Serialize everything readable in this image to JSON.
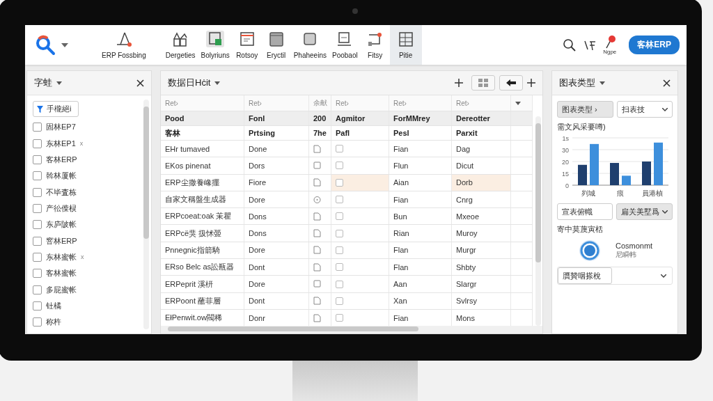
{
  "toolbar": {
    "tools": [
      {
        "label": "ERP Fossbing",
        "selected": false
      },
      {
        "label": "Dergeties",
        "selected": false
      },
      {
        "label": "Bolyriuns",
        "selected": false
      },
      {
        "label": "Rotsoy",
        "selected": false
      },
      {
        "label": "Eryctil",
        "selected": false
      },
      {
        "label": "Phaheeins",
        "selected": false
      },
      {
        "label": "Poobaol",
        "selected": false
      },
      {
        "label": "Fitsy",
        "selected": false
      },
      {
        "label": "Pitie",
        "selected": true
      }
    ],
    "notification_label": "Ngpe",
    "account_button": "客林ERP"
  },
  "left_panel": {
    "title": "字蛙",
    "filter": "手櫳絕i",
    "items": [
      {
        "label": "固林EP7",
        "checked": false
      },
      {
        "label": "东林EP1",
        "checked": false,
        "suffix": "x"
      },
      {
        "label": "客林ERP",
        "checked": false
      },
      {
        "label": "斡林厦帐",
        "checked": false
      },
      {
        "label": "不毕査栋",
        "checked": false
      },
      {
        "label": "产彸偨棂",
        "checked": false
      },
      {
        "label": "东庐陂帐",
        "checked": false
      },
      {
        "label": "窨林ERP",
        "checked": false
      },
      {
        "label": "东林蜜帐",
        "checked": false,
        "suffix": "x"
      },
      {
        "label": "客林蜜帐",
        "checked": false
      },
      {
        "label": "多屁蜜帐",
        "checked": false
      },
      {
        "label": "钍橘",
        "checked": false
      },
      {
        "label": "称杵",
        "checked": false
      }
    ]
  },
  "table_panel": {
    "title": "数据日Hċit",
    "table": {
      "columns": [
        "Ret›",
        "Ret›",
        "余献",
        "Ret›",
        "Ret›",
        "Ret›"
      ],
      "header_rows": [
        [
          "Pood",
          "Fonl",
          "200",
          "Agmitor",
          "ForMMrey",
          "Dereotter"
        ],
        [
          "客林",
          "Prtsing",
          "7he",
          "Pafl",
          "Pesl",
          "Parxit"
        ]
      ],
      "rows": [
        {
          "name": "EHr tumaved",
          "status": "Done",
          "kind": "doc",
          "checked": false,
          "column_5": "Fian",
          "column_6": "Dag",
          "selected": false
        },
        {
          "name": "EKos pinenat",
          "status": "Dors",
          "kind": "square",
          "checked": false,
          "column_5": "Flun",
          "column_6": "Dicut",
          "selected": false
        },
        {
          "name": "ERP尘撒養嶑擺",
          "status": "Fiore",
          "kind": "doc",
          "checked": false,
          "column_5": "Aian",
          "column_6": "Dorb",
          "selected": true
        },
        {
          "name": "自家文稱盤生成器",
          "status": "Dore",
          "kind": "clock",
          "checked": false,
          "column_5": "Fian",
          "column_6": "Cnrg",
          "selected": false
        },
        {
          "name": "ERPcoeat:oak 茉瞿",
          "status": "Dons",
          "kind": "doc",
          "checked": false,
          "column_5": "Bun",
          "column_6": "Mxeoe",
          "selected": false
        },
        {
          "name": "ERPcë猆 扱怵臦",
          "status": "Dons",
          "kind": "doc",
          "checked": false,
          "column_5": "Rian",
          "column_6": "Muroy",
          "selected": false
        },
        {
          "name": "Pnnegnic指箭騎",
          "status": "Dore",
          "kind": "doc",
          "checked": false,
          "column_5": "Flan",
          "column_6": "Murgr",
          "selected": false
        },
        {
          "name": "ERso Belc as訟瓶器",
          "status": "Dont",
          "kind": "doc",
          "checked": false,
          "column_5": "Flan",
          "column_6": "Shbty",
          "selected": false
        },
        {
          "name": "ERPeprit 溪枅",
          "status": "Dore",
          "kind": "square",
          "checked": false,
          "column_5": "Aan",
          "column_6": "Slargr",
          "selected": false
        },
        {
          "name": "ERPoont 蘸菲層",
          "status": "Dont",
          "kind": "doc",
          "checked": false,
          "column_5": "Xan",
          "column_6": "Svlrsy",
          "selected": false
        },
        {
          "name": "EłPenwit.ow閥稀",
          "status": "Donr",
          "kind": "doc",
          "checked": false,
          "column_5": "Fian",
          "column_6": "Mons",
          "selected": false
        }
      ]
    }
  },
  "chart_panel": {
    "title": "图表类型",
    "type_button": "图表类型 ›",
    "type_select": "扫表技",
    "chart": {
      "kind": "bar",
      "title": "需文风采要噂)",
      "categories": [
        "刿城",
        "痕",
        "員港楨"
      ],
      "tick_labels": [
        "1s",
        "30",
        "20",
        "15",
        "0"
      ]
    },
    "label_field": "宣表俯幟",
    "style_select": "扁关美墅爲",
    "section_label": "寄中莫蔑寅栝",
    "option_title": "Cosmonmt",
    "option_subtitle": "尼瞬帏",
    "bottom_select": "贋贊咽搽梲"
  }
}
